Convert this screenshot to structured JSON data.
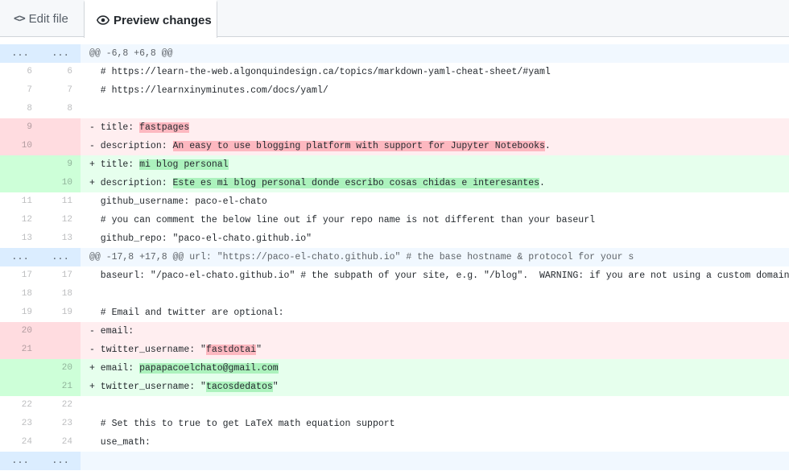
{
  "tabs": {
    "edit_label": "Edit file",
    "preview_label": "Preview changes"
  },
  "rows": [
    {
      "type": "hunk",
      "old": "...",
      "new": "...",
      "text": "@@ -6,8 +6,8 @@"
    },
    {
      "type": "ctx",
      "old": "6",
      "new": "6",
      "text": "  # https://learn-the-web.algonquindesign.ca/topics/markdown-yaml-cheat-sheet/#yaml"
    },
    {
      "type": "ctx",
      "old": "7",
      "new": "7",
      "text": "  # https://learnxinyminutes.com/docs/yaml/"
    },
    {
      "type": "ctx",
      "old": "8",
      "new": "8",
      "text": ""
    },
    {
      "type": "del",
      "old": "9",
      "new": "",
      "pre": "- title: ",
      "hl": "fastpages",
      "post": ""
    },
    {
      "type": "del",
      "old": "10",
      "new": "",
      "pre": "- description: ",
      "hl": "An easy to use blogging platform with support for Jupyter Notebooks",
      "post": "."
    },
    {
      "type": "add",
      "old": "",
      "new": "9",
      "pre": "+ title: ",
      "hl": "mi blog personal",
      "post": ""
    },
    {
      "type": "add",
      "old": "",
      "new": "10",
      "pre": "+ description: ",
      "hl": "Este es mi blog personal donde escribo cosas chidas e interesantes",
      "post": "."
    },
    {
      "type": "ctx",
      "old": "11",
      "new": "11",
      "text": "  github_username: paco-el-chato"
    },
    {
      "type": "ctx",
      "old": "12",
      "new": "12",
      "text": "  # you can comment the below line out if your repo name is not different than your baseurl"
    },
    {
      "type": "ctx",
      "old": "13",
      "new": "13",
      "text": "  github_repo: \"paco-el-chato.github.io\""
    },
    {
      "type": "hunk",
      "old": "...",
      "new": "...",
      "text": "@@ -17,8 +17,8 @@ url: \"https://paco-el-chato.github.io\" # the base hostname & protocol for your s"
    },
    {
      "type": "ctx",
      "old": "17",
      "new": "17",
      "text": "  baseurl: \"/paco-el-chato.github.io\" # the subpath of your site, e.g. \"/blog\".  WARNING: if you are not using a custom domain, the"
    },
    {
      "type": "ctx",
      "old": "18",
      "new": "18",
      "text": ""
    },
    {
      "type": "ctx",
      "old": "19",
      "new": "19",
      "text": "  # Email and twitter are optional:"
    },
    {
      "type": "del",
      "old": "20",
      "new": "",
      "pre": "- email:",
      "hl": "",
      "post": ""
    },
    {
      "type": "del",
      "old": "21",
      "new": "",
      "pre": "- twitter_username: \"",
      "hl": "fastdotai",
      "post": "\""
    },
    {
      "type": "add",
      "old": "",
      "new": "20",
      "pre": "+ email: ",
      "hl": "papapacoelchato@gmail.com",
      "post": ""
    },
    {
      "type": "add",
      "old": "",
      "new": "21",
      "pre": "+ twitter_username: \"",
      "hl": "tacosdedatos",
      "post": "\""
    },
    {
      "type": "ctx",
      "old": "22",
      "new": "22",
      "text": ""
    },
    {
      "type": "ctx",
      "old": "23",
      "new": "23",
      "text": "  # Set this to true to get LaTeX math equation support"
    },
    {
      "type": "ctx",
      "old": "24",
      "new": "24",
      "text": "  use_math:"
    },
    {
      "type": "hunk",
      "old": "...",
      "new": "...",
      "text": ""
    }
  ]
}
